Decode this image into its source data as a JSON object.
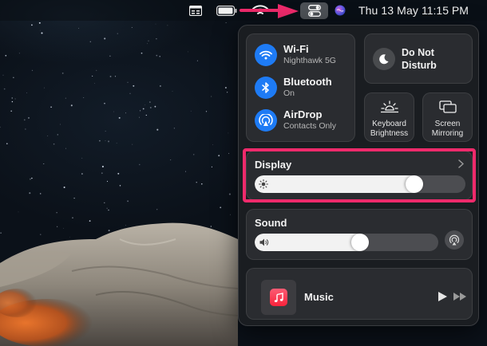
{
  "menubar": {
    "date": "Thu 13 May",
    "time": "11:15 PM",
    "icons": [
      "window-grid-icon",
      "battery-icon",
      "wifi-icon",
      "control-center-icon",
      "siri-icon"
    ]
  },
  "control_center": {
    "wifi": {
      "title": "Wi-Fi",
      "subtitle": "Nighthawk 5G"
    },
    "bluetooth": {
      "title": "Bluetooth",
      "subtitle": "On"
    },
    "airdrop": {
      "title": "AirDrop",
      "subtitle": "Contacts Only"
    },
    "dnd": {
      "line1": "Do Not",
      "line2": "Disturb"
    },
    "keyboard_brightness": {
      "line1": "Keyboard",
      "line2": "Brightness"
    },
    "screen_mirroring": {
      "line1": "Screen",
      "line2": "Mirroring"
    },
    "display": {
      "title": "Display",
      "level": 0.78
    },
    "sound": {
      "title": "Sound",
      "level": 0.58
    },
    "music": {
      "title": "Music"
    }
  },
  "colors": {
    "accent": "#1e7bf5",
    "highlight": "#ee2a6b",
    "annotation_arrow": "#ee2a6b"
  }
}
